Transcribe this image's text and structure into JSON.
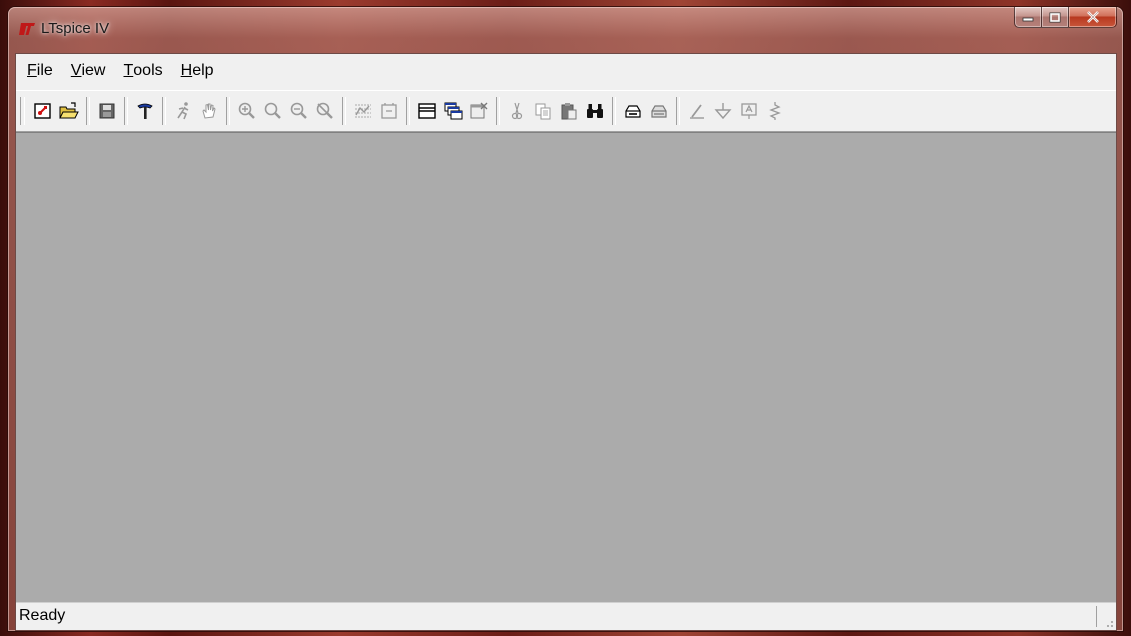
{
  "window": {
    "title": "LTspice IV"
  },
  "menu": [
    {
      "label": "File",
      "hotkey": "F",
      "rest": "ile"
    },
    {
      "label": "View",
      "hotkey": "V",
      "rest": "iew"
    },
    {
      "label": "Tools",
      "hotkey": "T",
      "rest": "ools"
    },
    {
      "label": "Help",
      "hotkey": "H",
      "rest": "elp"
    }
  ],
  "toolbar": {
    "icons": [
      "new-schematic-icon",
      "open-folder-icon",
      "save-icon",
      "control-panel-hammer-icon",
      "run-icon",
      "pan-hand-icon",
      "zoom-in-icon",
      "zoom-out-icon",
      "zoom-area-icon",
      "zoom-cancel-icon",
      "autorange-icon",
      "mark-icon",
      "tile-horizontal-icon",
      "cascade-icon",
      "window-close-icon",
      "cut-icon",
      "copy-icon",
      "paste-icon",
      "find-binoculars-icon",
      "print-preview-icon",
      "print-icon",
      "draw-wire-icon",
      "ground-icon",
      "label-net-icon",
      "resistor-icon"
    ]
  },
  "status": {
    "text": "Ready"
  },
  "colors": {
    "workspace": "#ababab",
    "accent_logo": "#c01818"
  }
}
